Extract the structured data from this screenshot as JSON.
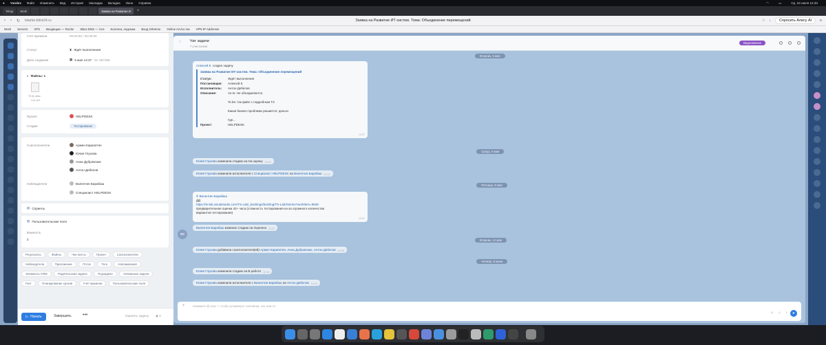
{
  "menubar": {
    "items": [
      "Yandex",
      "Файл",
      "Изменить",
      "Вид",
      "История",
      "Закладки",
      "Вкладка",
      "Окно",
      "Справка"
    ],
    "clock": "Ср, 24 июля 12:33"
  },
  "tabs": {
    "items": [
      "Telegr",
      "Work",
      "",
      "",
      "",
      "",
      "",
      "",
      "",
      "",
      ""
    ],
    "selected": "Заявка на Развитие И"
  },
  "address": {
    "url": "tstarter.bitrix24.ru",
    "page_title": "Заявка на Развитие ИТ-систем. Тема: Объединение перемещений",
    "ask": "Спросить Алису AI"
  },
  "bookmarks": [
    "Work",
    "Servers",
    "VPS",
    "Входящие — Rocke",
    "XBox DNS — Сез",
    "Коллеги, подскаж",
    "Вход GitVerse",
    "Online ArUco ma",
    "VPN IP Addresse"
  ],
  "task": {
    "top_label": "Учет времени",
    "top_value": "00:00:00 / 02:00:00",
    "status_label": "Статус",
    "status_value": "Ждёт выполнения",
    "created_label": "Дата создания",
    "created_value": "5 мая 14:37",
    "created_id": "ID: 587266",
    "files_title": "Файлы: 1",
    "file_name": "TZ-kt_obsc",
    "file_action": "ещё дей",
    "project_label": "Проект",
    "project_value": "HELPDESK",
    "stage_label": "Стадия",
    "stage_value": "Тестирование",
    "coexec_label": "Соисполнители",
    "coexec": [
      "Армен Карапетян",
      "Юлия Глухова",
      "Анна Дубровских",
      "Антон Дебелов"
    ],
    "observers_label": "Наблюдатели",
    "observers": [
      "Валентин Барабаш",
      "Специалист HELPDESK"
    ],
    "sprints": "Спринты",
    "custom_fields": "Пользовательские поля",
    "importance_label": "Важность",
    "importance_value": "2",
    "chips": [
      "Результаты",
      "Файлы",
      "Чек-листы",
      "Проект",
      "Соисполнители",
      "Наблюдатели",
      "Приложение",
      "Поток",
      "Теги",
      "Напоминания",
      "Элементы CRM",
      "Родительская задача",
      "Подзадачи",
      "Связанные задачи",
      "Гант",
      "Планирование сроков",
      "Учёт времени",
      "Пользовательские поля"
    ],
    "btn_start": "Начать",
    "btn_finish": "Завершить",
    "btn_more": "•••",
    "rate": "Оценить задачу",
    "views": "0"
  },
  "chat": {
    "title": "Чат задачи",
    "subtitle": "7 участников",
    "video": "Видеозвонок",
    "dates": [
      "Вторник, 5 мая",
      "Среда, 6 мая",
      "Пятница, 8 мая",
      "Вторник, 12 мая",
      "Четверг, 8 июня"
    ],
    "created_author": "Алексей К.",
    "created_verb": "создал задачу",
    "card_title": "Заявка на Развитие ИТ-систем. Тема: Объединение перемещений",
    "card_rows": [
      {
        "k": "Статус:",
        "v": "Ждёт выполнения"
      },
      {
        "k": "Постановщик:",
        "v": "Алексей К."
      },
      {
        "k": "Исполнитель:",
        "v": "Антон Дебелов"
      },
      {
        "k": "Описание:",
        "v": "As-Is: Не объединяются."
      }
    ],
    "card_desc_lines": [
      "To be: См файл с подробным ТЗ",
      "Какая бизнес-проблема решается: деньги",
      "Где..."
    ],
    "card_project_k": "Проект:",
    "card_project_v": "HELPDESK",
    "card_time": "14:37",
    "sys1_name": "Юлия Глухова",
    "sys1_text": "изменила стадию на На оценку",
    "sys1_time": "10:14",
    "sys2_name": "Юлия Глухова",
    "sys2_text": "изменила исполнителя с",
    "sys2_from": "Специалист HELPDESK",
    "sys2_on": "на",
    "sys2_to": "Валентин Барабаш",
    "sys2_time": "10:15",
    "msg_author": "Валентин Барабаш",
    "msg_line1": "ДД",
    "msg_link": "https://ts-lab.visualstudio.com/TS-Lab/_backlogs/backlog/TS-Lab/Stories?workitem=9539",
    "msg_line3": "предварительная оценка 42+ часа (сложность тестирования из-за огромного количества",
    "msg_line4": "вариантов тестирования)",
    "msg_time": "12:07",
    "msg_avatar": "ВБ",
    "sys3_name": "Валентин Барабаш",
    "sys3_text": "изменил стадию на Оценено",
    "sys3_time": "12:07",
    "sys4_name": "Юлия Глухова",
    "sys4_text": "добавила соисполнителя(ей)",
    "sys4_people": "Армен Карапетян, Анна Дубровских, Антон Дебелов",
    "sys4_time": "10:48",
    "sys5_name": "Юлия Глухова",
    "sys5_text": "изменила стадию на В работе",
    "sys5_time": "10:18",
    "sys6_name": "Юлия Глухова",
    "sys6_text": "изменила исполнителя с",
    "sys6_from": "Валентин Барабаш",
    "sys6_on": "на",
    "sys6_to": "Антон Дебелов",
    "sys6_time": "10:18",
    "input_placeholder": "Нажмите @ или +, чтобы упомянуть человека, чат или AI"
  }
}
